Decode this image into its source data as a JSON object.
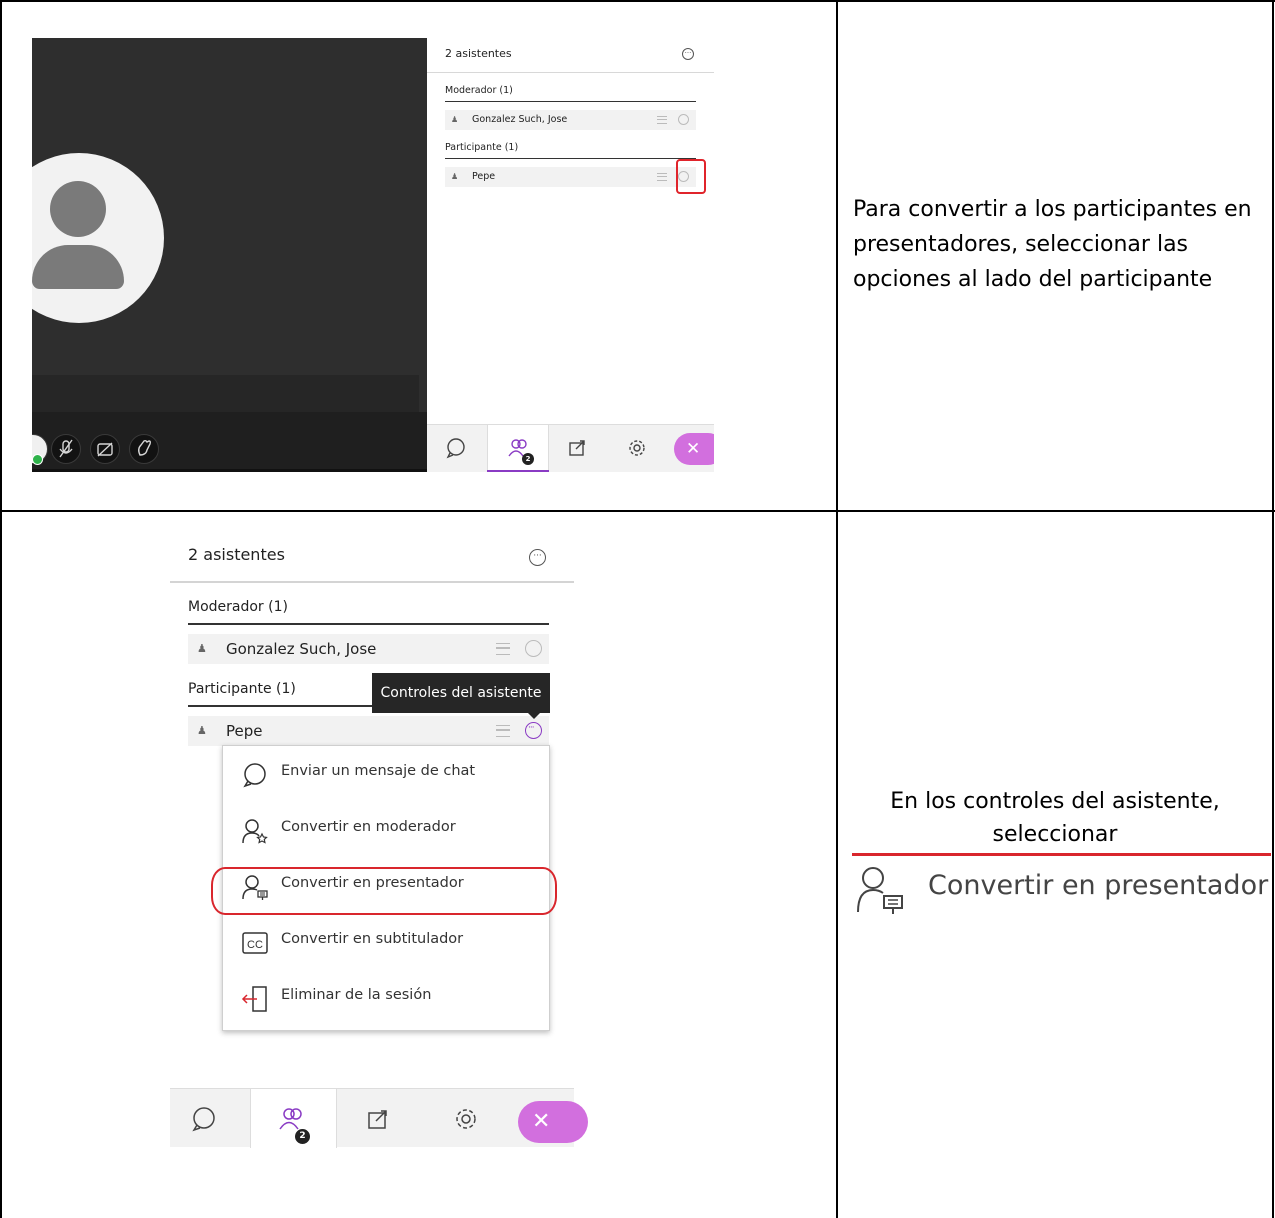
{
  "top_panel": {
    "title": "2 asistentes",
    "sections": [
      {
        "heading": "Moderador (1)",
        "attendee": "Gonzalez Such, Jose"
      },
      {
        "heading": "Participante (1)",
        "attendee": "Pepe"
      }
    ],
    "badge": "2"
  },
  "top_description": "Para convertir a los participantes en presentadores, seleccionar las opciones al lado del participante",
  "bottom_panel": {
    "title": "2 asistentes",
    "sections": [
      {
        "heading": "Moderador (1)",
        "attendee": "Gonzalez Such, Jose"
      },
      {
        "heading": "Participante (1)",
        "attendee": "Pepe"
      }
    ],
    "tooltip": "Controles del asistente",
    "menu": [
      {
        "label": "Enviar un mensaje de chat",
        "icon": "chat-bubble-icon"
      },
      {
        "label": "Convertir en moderador",
        "icon": "user-star-icon"
      },
      {
        "label": "Convertir en presentador",
        "icon": "user-presenter-icon"
      },
      {
        "label": "Convertir en subtitulador",
        "icon": "closed-caption-icon"
      },
      {
        "label": "Eliminar de la sesión",
        "icon": "exit-door-icon"
      }
    ],
    "badge": "2"
  },
  "bottom_description": {
    "line1": "En los controles del asistente,",
    "line2": "seleccionar",
    "highlight_label": "Convertir en presentador"
  },
  "colors": {
    "accent": "#8a3bc4",
    "close_pill": "#d26fde",
    "highlight_red": "#d9262d",
    "online": "#2eb24a"
  }
}
